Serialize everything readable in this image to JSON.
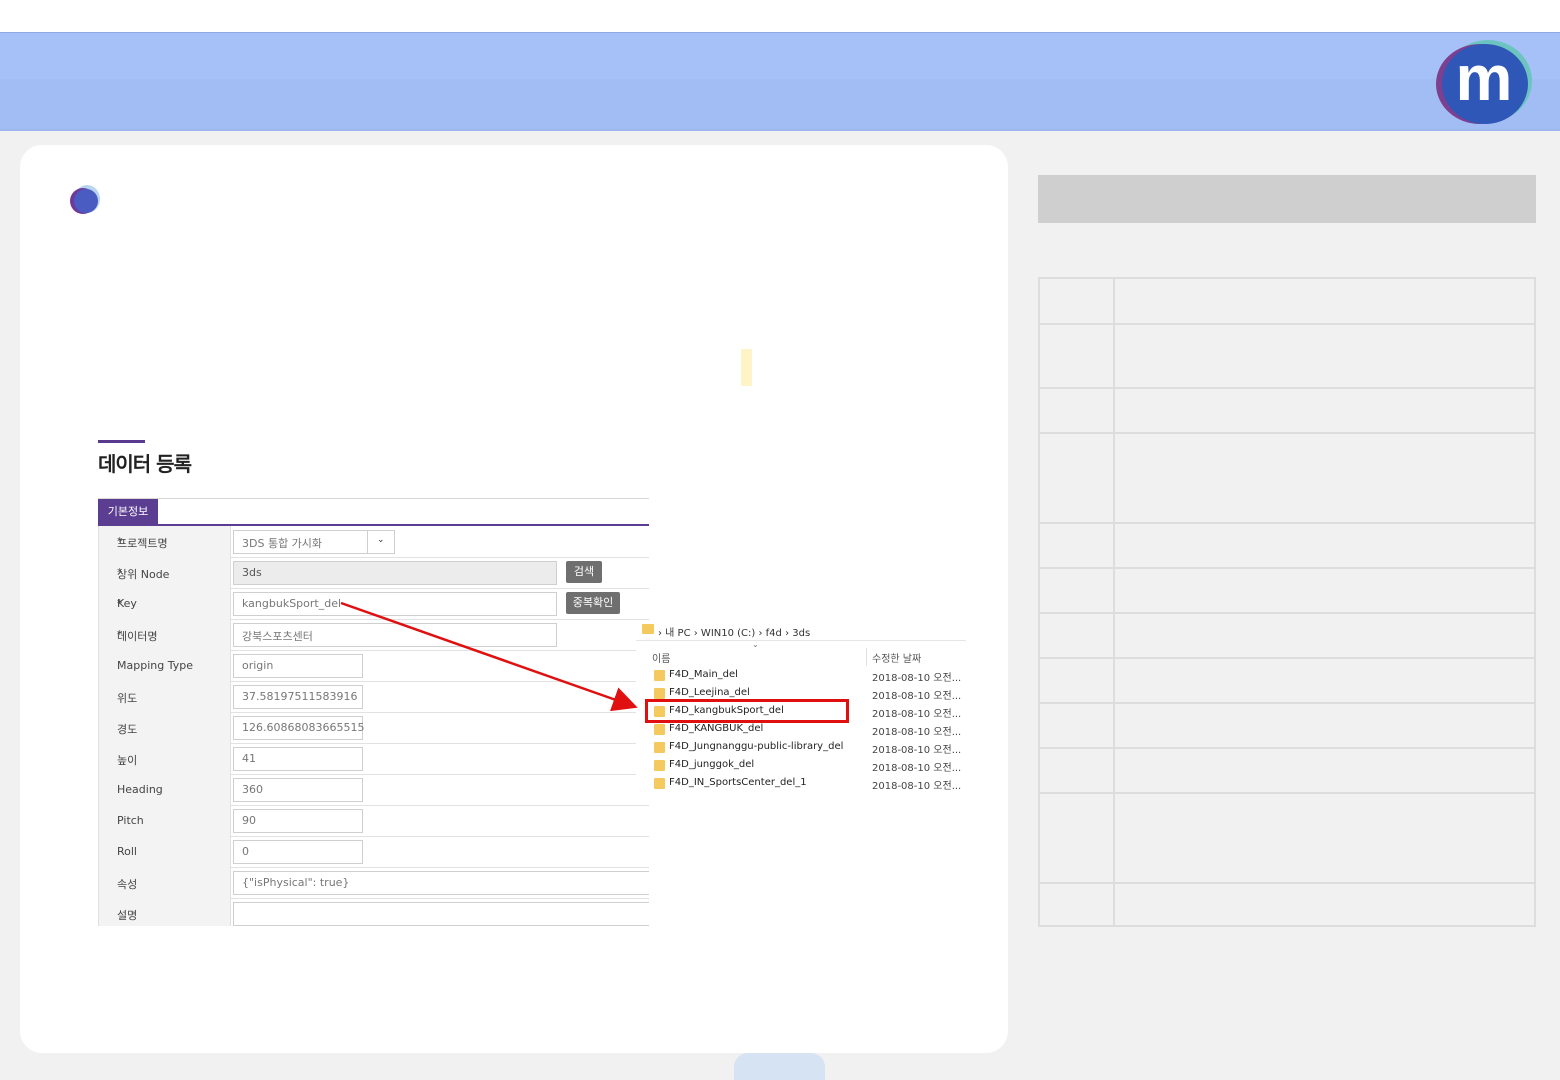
{
  "section": {
    "title": "데이터 등록"
  },
  "form": {
    "tab_label": "기본정보",
    "required_mark": "*",
    "rows": [
      {
        "label": "프로젝트명",
        "value": "3DS 통합 가시화",
        "required": true
      },
      {
        "label": "상위 Node",
        "value": "3ds",
        "required": true,
        "button": "검색"
      },
      {
        "label": "Key",
        "value": "kangbukSport_del",
        "required": true,
        "button": "중복확인"
      },
      {
        "label": "데이터명",
        "value": "강북스포츠센터",
        "required": true
      },
      {
        "label": "Mapping Type",
        "value": "origin"
      },
      {
        "label": "위도",
        "value": "37.58197511583916"
      },
      {
        "label": "경도",
        "value": "126.60868083665515"
      },
      {
        "label": "높이",
        "value": "41"
      },
      {
        "label": "Heading",
        "value": "360"
      },
      {
        "label": "Pitch",
        "value": "90"
      },
      {
        "label": "Roll",
        "value": "0"
      },
      {
        "label": "속성",
        "value": "{\"isPhysical\": true}"
      },
      {
        "label": "설명",
        "value": ""
      }
    ],
    "dropdown_caret": "⌄"
  },
  "explorer": {
    "path": "›  내 PC  ›  WIN10 (C:)  ›  f4d  ›  3ds",
    "sort_caret": "⌄",
    "col_name": "이름",
    "col_date": "수정한 날짜",
    "files": [
      {
        "name": "F4D_Main_del",
        "date": "2018-08-10 오전..."
      },
      {
        "name": "F4D_Leejina_del",
        "date": "2018-08-10 오전..."
      },
      {
        "name": "F4D_kangbukSport_del",
        "date": "2018-08-10 오전..."
      },
      {
        "name": "F4D_KANGBUK_del",
        "date": "2018-08-10 오전..."
      },
      {
        "name": "F4D_Jungnanggu-public-library_del",
        "date": "2018-08-10 오전..."
      },
      {
        "name": "F4D_junggok_del",
        "date": "2018-08-10 오전..."
      },
      {
        "name": "F4D_IN_SportsCenter_del_1",
        "date": "2018-08-10 오전..."
      }
    ],
    "highlighted_file_index": 2
  },
  "logo": {
    "letter": "m"
  },
  "colors": {
    "accent": "#5b3d91",
    "highlight": "#e01010",
    "header": "#a6c1f7"
  }
}
